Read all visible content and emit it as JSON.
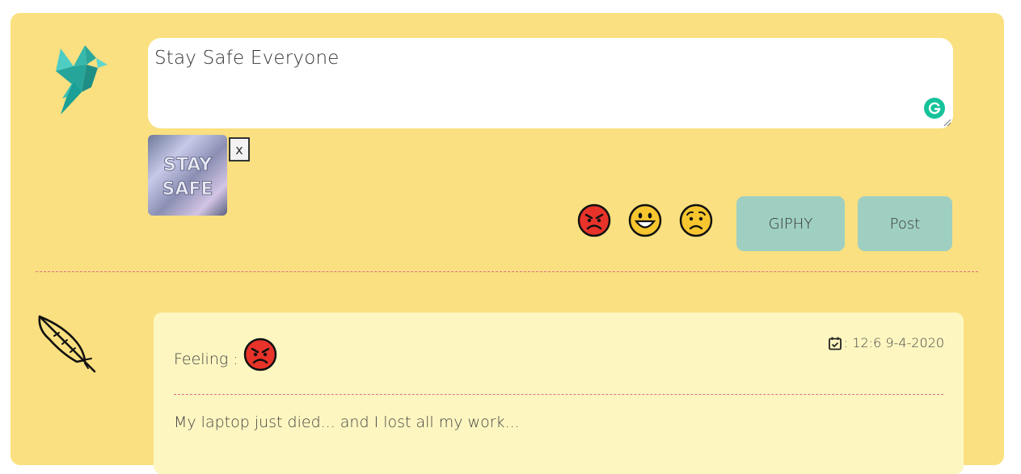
{
  "compose": {
    "text": "Stay Safe Everyone",
    "attachment_alt": "STAY SAFE",
    "remove_label": "x"
  },
  "toolbar": {
    "emojis": [
      "angry-face",
      "grinning-face",
      "worried-face"
    ],
    "giphy_label": "GIPHY",
    "post_label": "Post"
  },
  "post": {
    "feeling_label": "Feeling :",
    "feeling_emoji": "angry-face",
    "timestamp": ": 12:6 9-4-2020",
    "body": "My laptop just died... and I lost all my work..."
  },
  "colors": {
    "panel": "#fae080",
    "card": "#fdf6c0",
    "button": "#9fcfc1",
    "divider": "#e06a87",
    "logo_teal": "#1fb5a6"
  }
}
